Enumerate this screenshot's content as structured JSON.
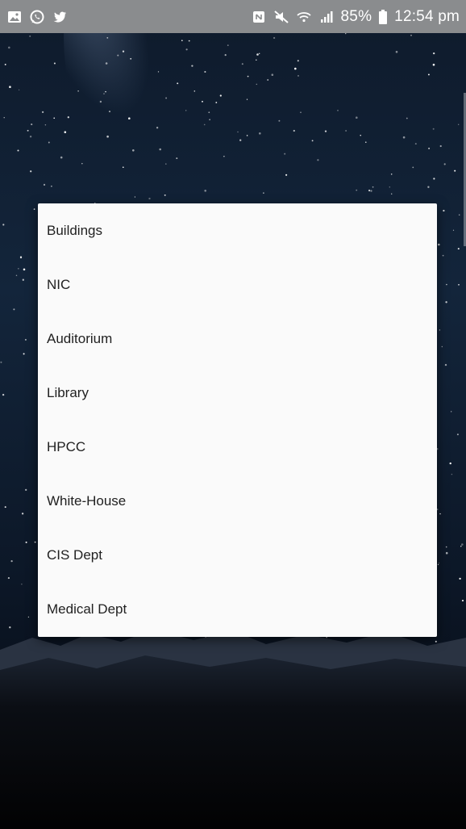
{
  "status_bar": {
    "notification_icons": [
      "gallery-icon",
      "whatsapp-icon",
      "twitter-icon"
    ],
    "system_icons": [
      "nfc-icon",
      "mute-icon",
      "wifi-icon",
      "signal-icon"
    ],
    "battery": "85%",
    "time": "12:54 pm"
  },
  "dialog": {
    "items": [
      {
        "label": "Buildings"
      },
      {
        "label": "NIC"
      },
      {
        "label": "Auditorium"
      },
      {
        "label": "Library"
      },
      {
        "label": "HPCC"
      },
      {
        "label": "White-House"
      },
      {
        "label": "CIS Dept"
      },
      {
        "label": "Medical Dept"
      }
    ]
  },
  "colors": {
    "status_bar_bg": "#8a8c8e",
    "dialog_bg": "#fafafa",
    "item_text": "#212121"
  }
}
